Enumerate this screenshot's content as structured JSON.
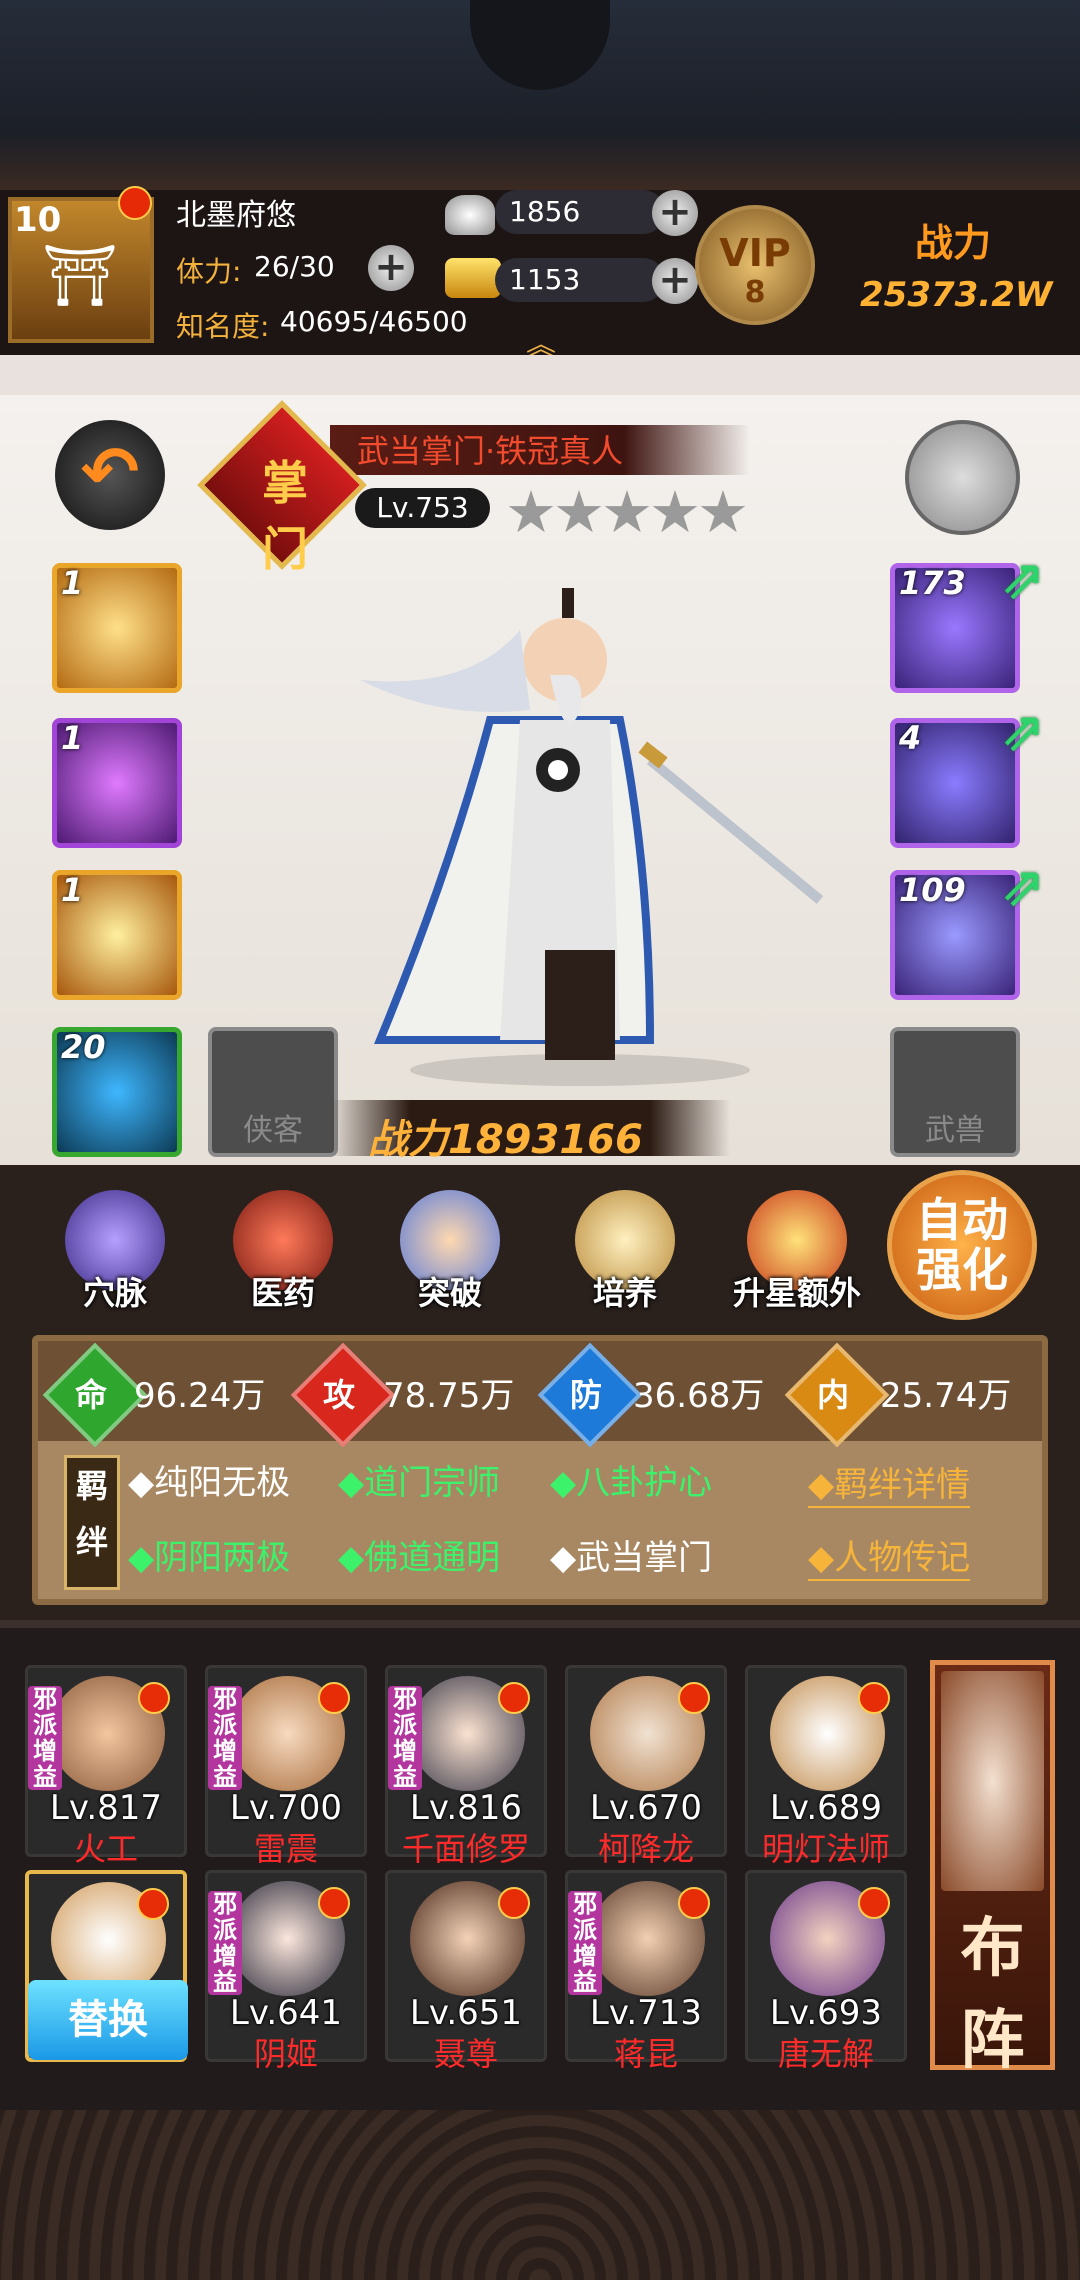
{
  "player": {
    "level": "10",
    "name": "北墨府悠",
    "stamina_label": "体力:",
    "stamina_value": "26/30",
    "fame_label": "知名度:",
    "fame_value": "40695/46500",
    "silver": "1856",
    "gold": "1153",
    "vip_text": "VIP",
    "vip_level": "8",
    "power_label": "战力",
    "power_value": "25373.2W"
  },
  "hero": {
    "badge": "掌门",
    "name": "武当掌门·铁冠真人",
    "level": "Lv.753",
    "stars": "★★★★★",
    "power": "战力1893166",
    "skills": [
      "1",
      "1",
      "1",
      "20"
    ],
    "xiake_label": "侠客",
    "equips": [
      "173",
      "4",
      "109"
    ],
    "wushou_label": "武兽"
  },
  "actions": [
    "穴脉",
    "医药",
    "突破",
    "培养",
    "升星额外"
  ],
  "auto_label": "自动强化",
  "attributes": [
    {
      "char": "命",
      "value": "96.24万",
      "color": "#2fa72f"
    },
    {
      "char": "攻",
      "value": "78.75万",
      "color": "#d8281e"
    },
    {
      "char": "防",
      "value": "36.68万",
      "color": "#1e7ad8"
    },
    {
      "char": "内",
      "value": "25.74万",
      "color": "#d88a12"
    }
  ],
  "bond_tag": "羁绊",
  "bonds": [
    {
      "text": "◆纯阳无极",
      "color": "white"
    },
    {
      "text": "◆道门宗师",
      "color": "green"
    },
    {
      "text": "◆八卦护心",
      "color": "green"
    },
    {
      "text": "◆羁绊详情",
      "color": "orange"
    },
    {
      "text": "◆阴阳两极",
      "color": "green"
    },
    {
      "text": "◆佛道通明",
      "color": "green"
    },
    {
      "text": "◆武当掌门",
      "color": "white"
    },
    {
      "text": "◆人物传记",
      "color": "orange"
    }
  ],
  "evil_tag": "邪派增益",
  "team": [
    {
      "lv": "Lv.817",
      "name": "火工"
    },
    {
      "lv": "Lv.700",
      "name": "雷震"
    },
    {
      "lv": "Lv.816",
      "name": "千面修罗"
    },
    {
      "lv": "Lv.670",
      "name": "柯降龙"
    },
    {
      "lv": "Lv.689",
      "name": "明灯法师"
    },
    {
      "lv": "Lv.641",
      "name": "阴姬"
    },
    {
      "lv": "Lv.651",
      "name": "聂尊"
    },
    {
      "lv": "Lv.713",
      "name": "蒋昆"
    },
    {
      "lv": "Lv.693",
      "name": "唐无解"
    }
  ],
  "replace_label": "替换",
  "formation_label": "布阵"
}
